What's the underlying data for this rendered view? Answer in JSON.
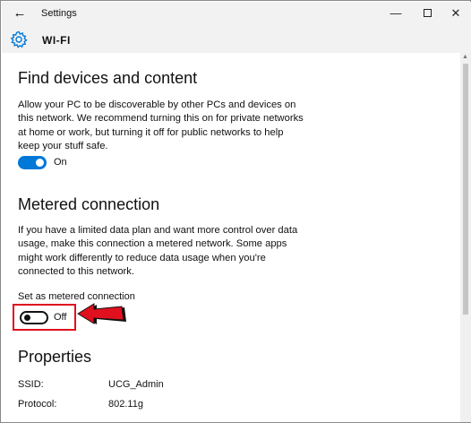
{
  "window": {
    "title": "Settings",
    "back_glyph": "←",
    "minimize_glyph": "—",
    "close_glyph": "✕"
  },
  "header": {
    "icon": "gear-icon",
    "title": "WI-FI"
  },
  "find_devices": {
    "heading": "Find devices and content",
    "description": "Allow your PC to be discoverable by other PCs and devices on this network. We recommend turning this on for private networks at home or work, but turning it off for public networks to help keep your stuff safe.",
    "toggle_state": "On"
  },
  "metered": {
    "heading": "Metered connection",
    "description": "If you have a limited data plan and want more control over data usage, make this connection a metered network. Some apps might work differently to reduce data usage when you're connected to this network.",
    "setting_label": "Set as metered connection",
    "toggle_state": "Off"
  },
  "properties": {
    "heading": "Properties",
    "rows": [
      {
        "key": "SSID:",
        "value": "UCG_Admin"
      },
      {
        "key": "Protocol:",
        "value": "802.11g"
      }
    ]
  },
  "colors": {
    "accent": "#0078d7",
    "highlight": "#e0101e"
  }
}
